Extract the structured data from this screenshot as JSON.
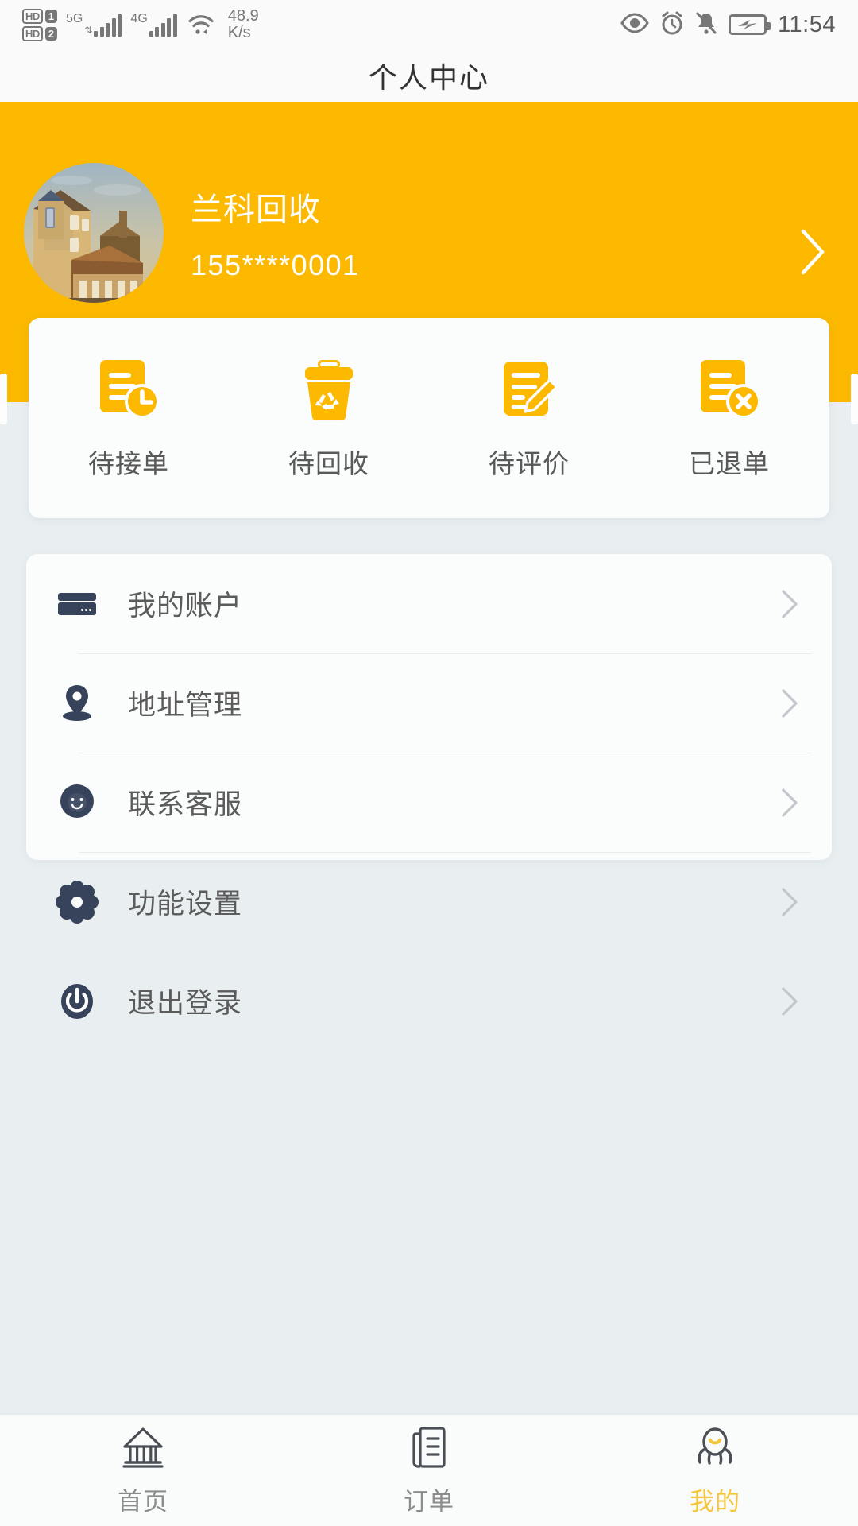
{
  "status_bar": {
    "hd1_label": "HD",
    "hd1_num": "1",
    "hd2_label": "HD",
    "hd2_num": "2",
    "sim1_net": "5G",
    "sim2_net": "4G",
    "net_speed_value": "48.9",
    "net_speed_unit": "K/s",
    "clock": "11:54",
    "icons": [
      "eye-icon",
      "alarm-icon",
      "bell-muted-icon",
      "battery-charging-icon"
    ]
  },
  "header": {
    "title": "个人中心"
  },
  "profile": {
    "name": "兰科回收",
    "phone": "155****0001",
    "avatar_alt": "avatar-photo",
    "chevron": "chevron-right-icon",
    "background_color": "#fcb900"
  },
  "quick_actions": [
    {
      "label": "待接单",
      "icon": "doc-clock-icon"
    },
    {
      "label": "待回收",
      "icon": "recycle-bin-icon"
    },
    {
      "label": "待评价",
      "icon": "doc-pencil-icon"
    },
    {
      "label": "已退单",
      "icon": "doc-cancel-icon"
    }
  ],
  "menu": [
    {
      "label": "我的账户",
      "icon": "credit-card-icon"
    },
    {
      "label": "地址管理",
      "icon": "location-pin-icon"
    },
    {
      "label": "联系客服",
      "icon": "headset-support-icon"
    },
    {
      "label": "功能设置",
      "icon": "gear-icon"
    },
    {
      "label": "退出登录",
      "icon": "power-icon"
    }
  ],
  "tabbar": [
    {
      "label": "首页",
      "icon": "home-building-icon",
      "active": false
    },
    {
      "label": "订单",
      "icon": "order-list-icon",
      "active": false
    },
    {
      "label": "我的",
      "icon": "profile-person-icon",
      "active": true
    }
  ],
  "colors": {
    "accent_yellow": "#fcb900",
    "tab_active": "#f5c53a",
    "icon_dark": "#36435a",
    "page_bg": "#e9eff1",
    "card_bg": "#fbfcfc"
  }
}
